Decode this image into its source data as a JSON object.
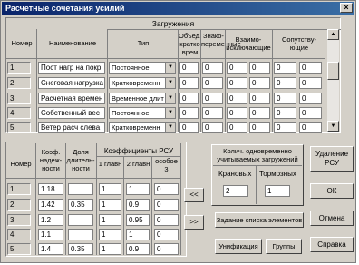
{
  "window": {
    "title": "Расчетные сочетания усилий",
    "close": "×"
  },
  "top": {
    "group_title": "Загружения",
    "headers": {
      "num": "Номер",
      "name": "Наименование",
      "type": "Тип",
      "obed": "Объед. кратко врем",
      "znako": "Знако- переменные",
      "vzaimo": "Взаимо- исключающие",
      "sopu": "Сопутству- ющие"
    },
    "rows": [
      {
        "num": "1",
        "name": "Пост нагр на покр",
        "type": "Постоянное",
        "v": [
          "0",
          "0",
          "0",
          "0",
          "0",
          "0"
        ]
      },
      {
        "num": "2",
        "name": "Снеговая нагрузка",
        "type": "Кратковременн",
        "v": [
          "0",
          "0",
          "0",
          "0",
          "0",
          "0"
        ]
      },
      {
        "num": "3",
        "name": "Расчетная времен",
        "type": "Временное длит",
        "v": [
          "0",
          "0",
          "0",
          "0",
          "0",
          "0"
        ]
      },
      {
        "num": "4",
        "name": "Собственный вес",
        "type": "Постоянное",
        "v": [
          "0",
          "0",
          "0",
          "0",
          "0",
          "0"
        ]
      },
      {
        "num": "5",
        "name": "Ветер расч слева",
        "type": "Кратковременн",
        "v": [
          "0",
          "0",
          "0",
          "0",
          "0",
          "0"
        ]
      }
    ]
  },
  "bottom": {
    "headers": {
      "num": "Номер",
      "koef": "Коэф. надеж- ности",
      "dolya": "Доля длитель- ности",
      "rsu": "Коэффициенты РСУ",
      "g1": "1 главн",
      "g2": "2 главн",
      "osob": "особое 3"
    },
    "rows": [
      {
        "num": "1",
        "v": [
          "1.18",
          "",
          "1",
          "1",
          "0"
        ]
      },
      {
        "num": "2",
        "v": [
          "1.42",
          "0.35",
          "1",
          "0.9",
          "0"
        ]
      },
      {
        "num": "3",
        "v": [
          "1.2",
          "",
          "1",
          "0.95",
          "0"
        ]
      },
      {
        "num": "4",
        "v": [
          "1.1",
          "",
          "1",
          "1",
          "0"
        ]
      },
      {
        "num": "5",
        "v": [
          "1.4",
          "0.35",
          "1",
          "0.9",
          "0"
        ]
      }
    ]
  },
  "arrows": {
    "left": "<<",
    "right": ">>"
  },
  "kolich": {
    "title": "Колич. одновременно учитываемых загружений",
    "kran_label": "Крановых",
    "torm_label": "Тормозных",
    "kran_value": "2",
    "torm_value": "1"
  },
  "buttons": {
    "delete": "Удаление РСУ",
    "ok": "ОК",
    "cancel": "Отмена",
    "help": "Справка",
    "spisok": "Задание списка элементов",
    "unif": "Унификация",
    "groups": "Группы"
  }
}
